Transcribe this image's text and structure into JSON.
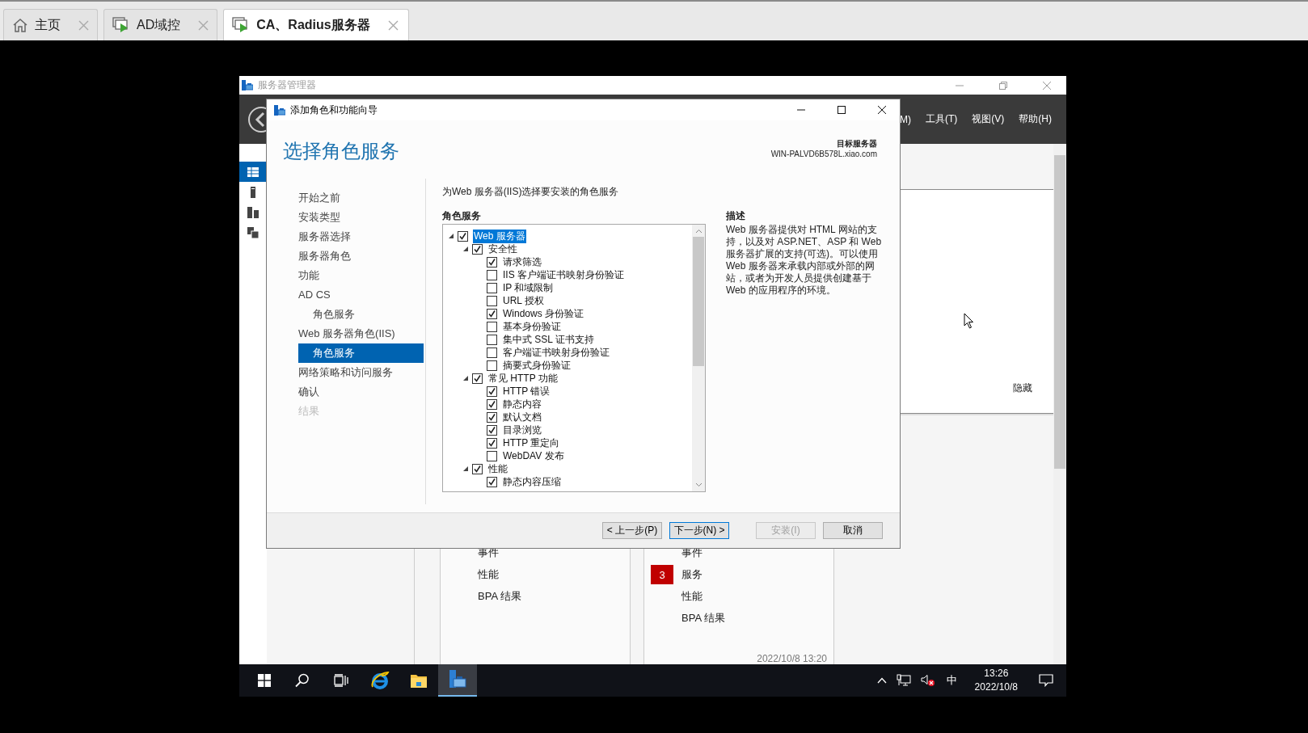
{
  "vm_tabs": [
    {
      "label": "主页",
      "kind": "home",
      "selected": false
    },
    {
      "label": "AD域控",
      "kind": "vm",
      "selected": false
    },
    {
      "label": "CA、Radius服务器",
      "kind": "vm",
      "selected": true
    }
  ],
  "server_manager": {
    "title": "服务器管理器",
    "menus": [
      "M)",
      "工具(T)",
      "视图(V)",
      "帮助(H)"
    ],
    "sidebar": [
      {
        "kind": "dashboard",
        "selected": true
      },
      {
        "kind": "server",
        "selected": false
      },
      {
        "kind": "servers",
        "selected": false
      },
      {
        "kind": "roles",
        "selected": false
      }
    ],
    "hide_link": "隐藏",
    "tiles": [
      {
        "items": [
          {
            "label": "事件"
          },
          {
            "label": "性能"
          },
          {
            "label": "BPA 结果"
          }
        ]
      },
      {
        "items": [
          {
            "label": "事件"
          },
          {
            "label": "服务",
            "badge": "3"
          },
          {
            "label": "性能"
          },
          {
            "label": "BPA 结果"
          }
        ],
        "timestamp": "2022/10/8 13:20"
      }
    ]
  },
  "wizard": {
    "title": "添加角色和功能向导",
    "heading": "选择角色服务",
    "target_label": "目标服务器",
    "target_server": "WIN-PALVD6B578L.xiao.com",
    "steps": [
      {
        "label": "开始之前",
        "selected": false,
        "disabled": false
      },
      {
        "label": "安装类型",
        "selected": false,
        "disabled": false
      },
      {
        "label": "服务器选择",
        "selected": false,
        "disabled": false
      },
      {
        "label": "服务器角色",
        "selected": false,
        "disabled": false
      },
      {
        "label": "功能",
        "selected": false,
        "disabled": false
      },
      {
        "label": "AD CS",
        "selected": false,
        "disabled": false,
        "children": [
          {
            "label": "角色服务",
            "selected": false,
            "disabled": false
          }
        ]
      },
      {
        "label": "Web 服务器角色(IIS)",
        "selected": false,
        "disabled": false,
        "children": [
          {
            "label": "角色服务",
            "selected": true,
            "disabled": false
          }
        ]
      },
      {
        "label": "网络策略和访问服务",
        "selected": false,
        "disabled": false
      },
      {
        "label": "确认",
        "selected": false,
        "disabled": false
      },
      {
        "label": "结果",
        "selected": false,
        "disabled": true
      }
    ],
    "instruction": "为Web 服务器(IIS)选择要安装的角色服务",
    "tree_heading": "角色服务",
    "tree": [
      {
        "label": "Web 服务器",
        "checked": true,
        "expanded": true,
        "selected": true,
        "children": [
          {
            "label": "安全性",
            "checked": true,
            "expanded": true,
            "selected": false,
            "children": [
              {
                "label": "请求筛选",
                "checked": true,
                "selected": false
              },
              {
                "label": "IIS 客户端证书映射身份验证",
                "checked": false,
                "selected": false
              },
              {
                "label": "IP 和域限制",
                "checked": false,
                "selected": false
              },
              {
                "label": "URL 授权",
                "checked": false,
                "selected": false
              },
              {
                "label": "Windows 身份验证",
                "checked": true,
                "selected": false
              },
              {
                "label": "基本身份验证",
                "checked": false,
                "selected": false
              },
              {
                "label": "集中式 SSL 证书支持",
                "checked": false,
                "selected": false
              },
              {
                "label": "客户端证书映射身份验证",
                "checked": false,
                "selected": false
              },
              {
                "label": "摘要式身份验证",
                "checked": false,
                "selected": false
              }
            ]
          },
          {
            "label": "常见 HTTP 功能",
            "checked": true,
            "expanded": true,
            "selected": false,
            "children": [
              {
                "label": "HTTP 错误",
                "checked": true,
                "selected": false
              },
              {
                "label": "静态内容",
                "checked": true,
                "selected": false
              },
              {
                "label": "默认文档",
                "checked": true,
                "selected": false
              },
              {
                "label": "目录浏览",
                "checked": true,
                "selected": false
              },
              {
                "label": "HTTP 重定向",
                "checked": true,
                "selected": false
              },
              {
                "label": "WebDAV 发布",
                "checked": false,
                "selected": false
              }
            ]
          },
          {
            "label": "性能",
            "checked": true,
            "expanded": true,
            "selected": false,
            "children": [
              {
                "label": "静态内容压缩",
                "checked": true,
                "selected": false
              }
            ]
          }
        ]
      }
    ],
    "description_heading": "描述",
    "description": "Web 服务器提供对 HTML 网站的支持，以及对 ASP.NET、ASP 和 Web 服务器扩展的支持(可选)。可以使用 Web 服务器来承载内部或外部的网站，或者为开发人员提供创建基于 Web 的应用程序的环境。",
    "buttons": [
      {
        "label": "< 上一步(P)",
        "disabled": false,
        "default": false
      },
      {
        "label": "下一步(N) >",
        "disabled": false,
        "default": true
      },
      {
        "label": "安装(I)",
        "disabled": true,
        "default": false
      },
      {
        "label": "取消",
        "disabled": false,
        "default": false
      }
    ]
  },
  "taskbar": {
    "apps": [
      {
        "kind": "ie",
        "selected": false
      },
      {
        "kind": "explorer",
        "selected": false
      },
      {
        "kind": "server-manager",
        "selected": true
      }
    ],
    "language": "中",
    "time": "13:26",
    "date": "2022/10/8"
  }
}
